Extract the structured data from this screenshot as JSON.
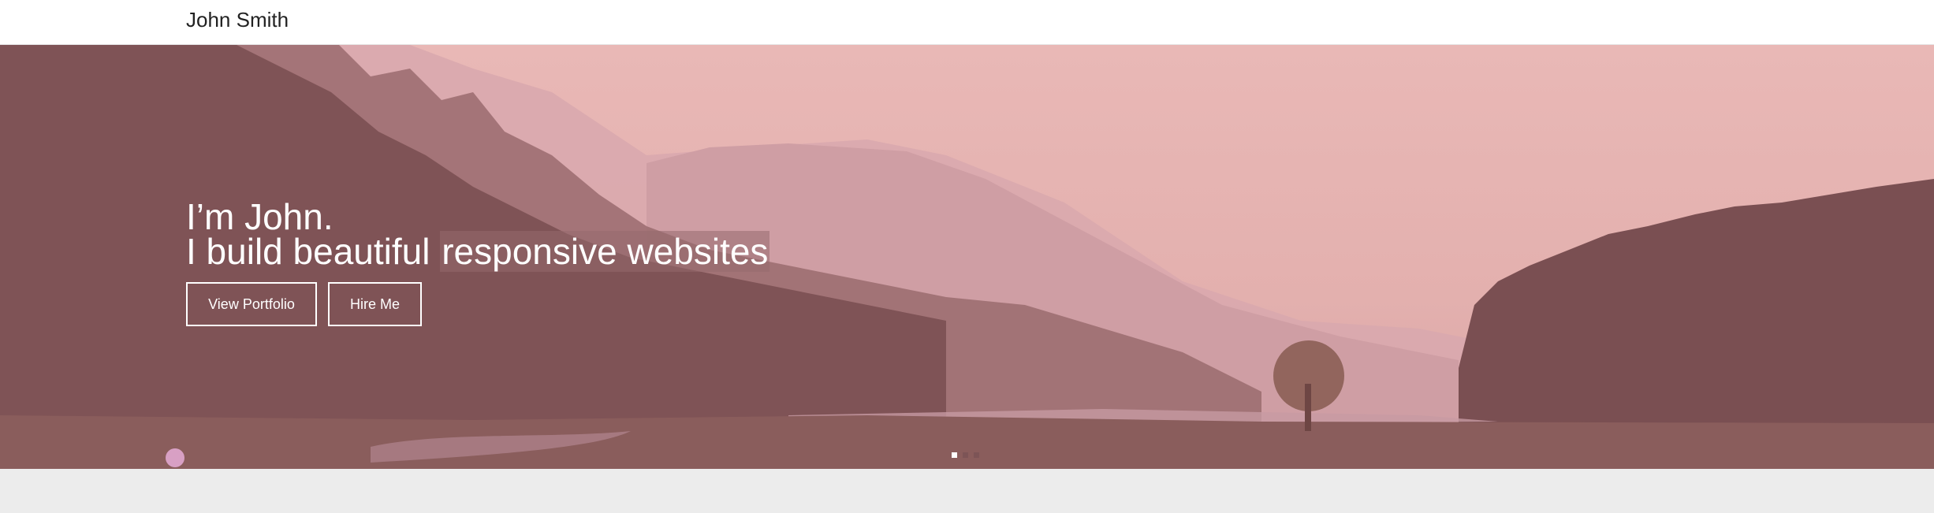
{
  "navbar": {
    "brand": "John Smith"
  },
  "hero": {
    "greeting": "I’m John.",
    "tagline_prefix": "I build beautiful",
    "tagline_highlight": "responsive websites",
    "buttons": {
      "portfolio_label": "View Portfolio",
      "hire_label": "Hire Me"
    },
    "slider": {
      "total": 3,
      "active_index": 0
    }
  },
  "colors": {
    "hero_overlay": "#a8787c",
    "highlight_bg": "#96696e",
    "navbar_bg": "#ffffff",
    "page_bg": "#ececec"
  }
}
